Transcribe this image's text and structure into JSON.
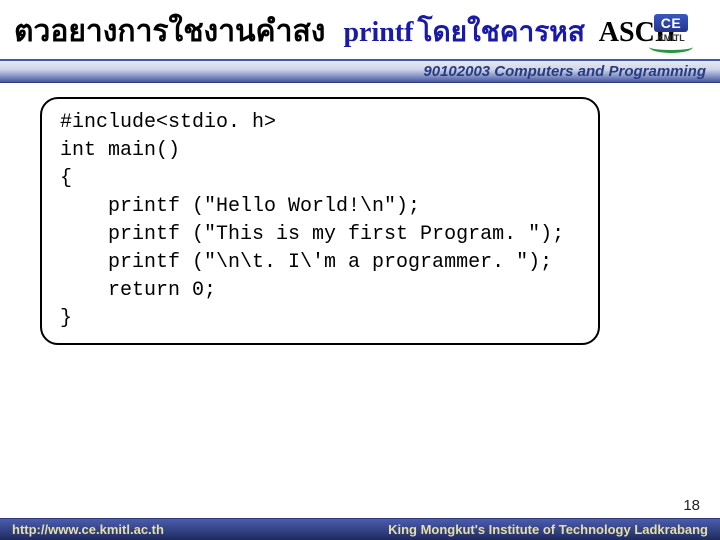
{
  "title": {
    "thai_prefix": "ตวอยางการใชงานคำสง",
    "printf": "printf",
    "thai_suffix": "โดยใชคารหส",
    "ascii": "ASCII"
  },
  "logo": {
    "ce": "CE",
    "kmitl": "KMITL"
  },
  "course": "90102003 Computers and Programming",
  "code": "#include<stdio. h>\nint main()\n{\n    printf (\"Hello World!\\n\");\n    printf (\"This is my first Program. \");\n    printf (\"\\n\\t. I\\'m a programmer. \");\n    return 0;\n}",
  "page_number": "18",
  "footer": {
    "url": "http://www.ce.kmitl.ac.th",
    "institute": "King Mongkut's Institute of Technology Ladkrabang"
  }
}
